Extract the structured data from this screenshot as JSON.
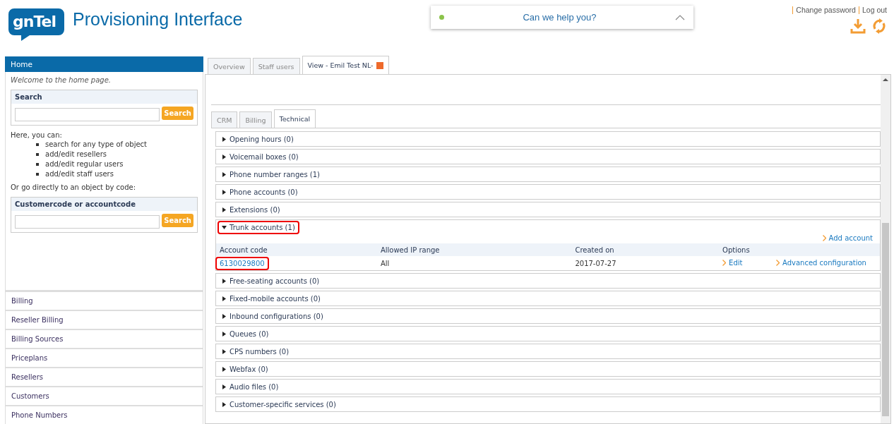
{
  "header": {
    "logo": "gnTel",
    "title": "Provisioning Interface",
    "help": {
      "label": "Can we help you?",
      "online": true
    },
    "links": [
      "Change password",
      "Log out"
    ]
  },
  "sidebar": {
    "title": "Home",
    "welcome": "Welcome to the home page.",
    "search": {
      "title": "Search",
      "button": "Search"
    },
    "intro": "Here, you can:",
    "bullets": [
      "search for any type of object",
      "add/edit resellers",
      "add/edit regular users",
      "add/edit staff users"
    ],
    "direct": "Or go directly to an object by code:",
    "code_search": {
      "title": "Customercode or accountcode",
      "button": "Search"
    },
    "items": [
      "Billing",
      "Reseller Billing",
      "Billing Sources",
      "Priceplans",
      "Resellers",
      "Customers",
      "Phone Numbers"
    ]
  },
  "tabs": [
    {
      "label": "Overview",
      "selected": false,
      "closable": false
    },
    {
      "label": "Staff users",
      "selected": false,
      "closable": false
    },
    {
      "label": "View - Emil Test NL-",
      "selected": true,
      "closable": true
    }
  ],
  "subtabs": [
    {
      "label": "CRM",
      "selected": false
    },
    {
      "label": "Billing",
      "selected": false
    },
    {
      "label": "Technical",
      "selected": true
    }
  ],
  "sections": [
    {
      "label": "Opening hours (0)",
      "expanded": false,
      "highlighted": false
    },
    {
      "label": "Voicemail boxes (0)",
      "expanded": false,
      "highlighted": false
    },
    {
      "label": "Phone number ranges (1)",
      "expanded": false,
      "highlighted": false
    },
    {
      "label": "Phone accounts (0)",
      "expanded": false,
      "highlighted": false
    },
    {
      "label": "Extensions (0)",
      "expanded": false,
      "highlighted": false
    },
    {
      "label": "Trunk accounts (1)",
      "expanded": true,
      "highlighted": true,
      "add_link": "Add account",
      "columns": [
        "Account code",
        "Allowed IP range",
        "Created on",
        "Options",
        ""
      ],
      "rows": [
        {
          "code": "6130029800",
          "highlighted": true,
          "ip_range": "All",
          "created": "2017-07-27",
          "edit": "Edit",
          "advanced": "Advanced configuration"
        }
      ]
    },
    {
      "label": "Free-seating accounts (0)",
      "expanded": false,
      "highlighted": false
    },
    {
      "label": "Fixed-mobile accounts (0)",
      "expanded": false,
      "highlighted": false
    },
    {
      "label": "Inbound configurations (0)",
      "expanded": false,
      "highlighted": false
    },
    {
      "label": "Queues (0)",
      "expanded": false,
      "highlighted": false
    },
    {
      "label": "CPS numbers (0)",
      "expanded": false,
      "highlighted": false
    },
    {
      "label": "Webfax (0)",
      "expanded": false,
      "highlighted": false
    },
    {
      "label": "Audio files (0)",
      "expanded": false,
      "highlighted": false
    },
    {
      "label": "Customer-specific services (0)",
      "expanded": false,
      "highlighted": false
    }
  ]
}
